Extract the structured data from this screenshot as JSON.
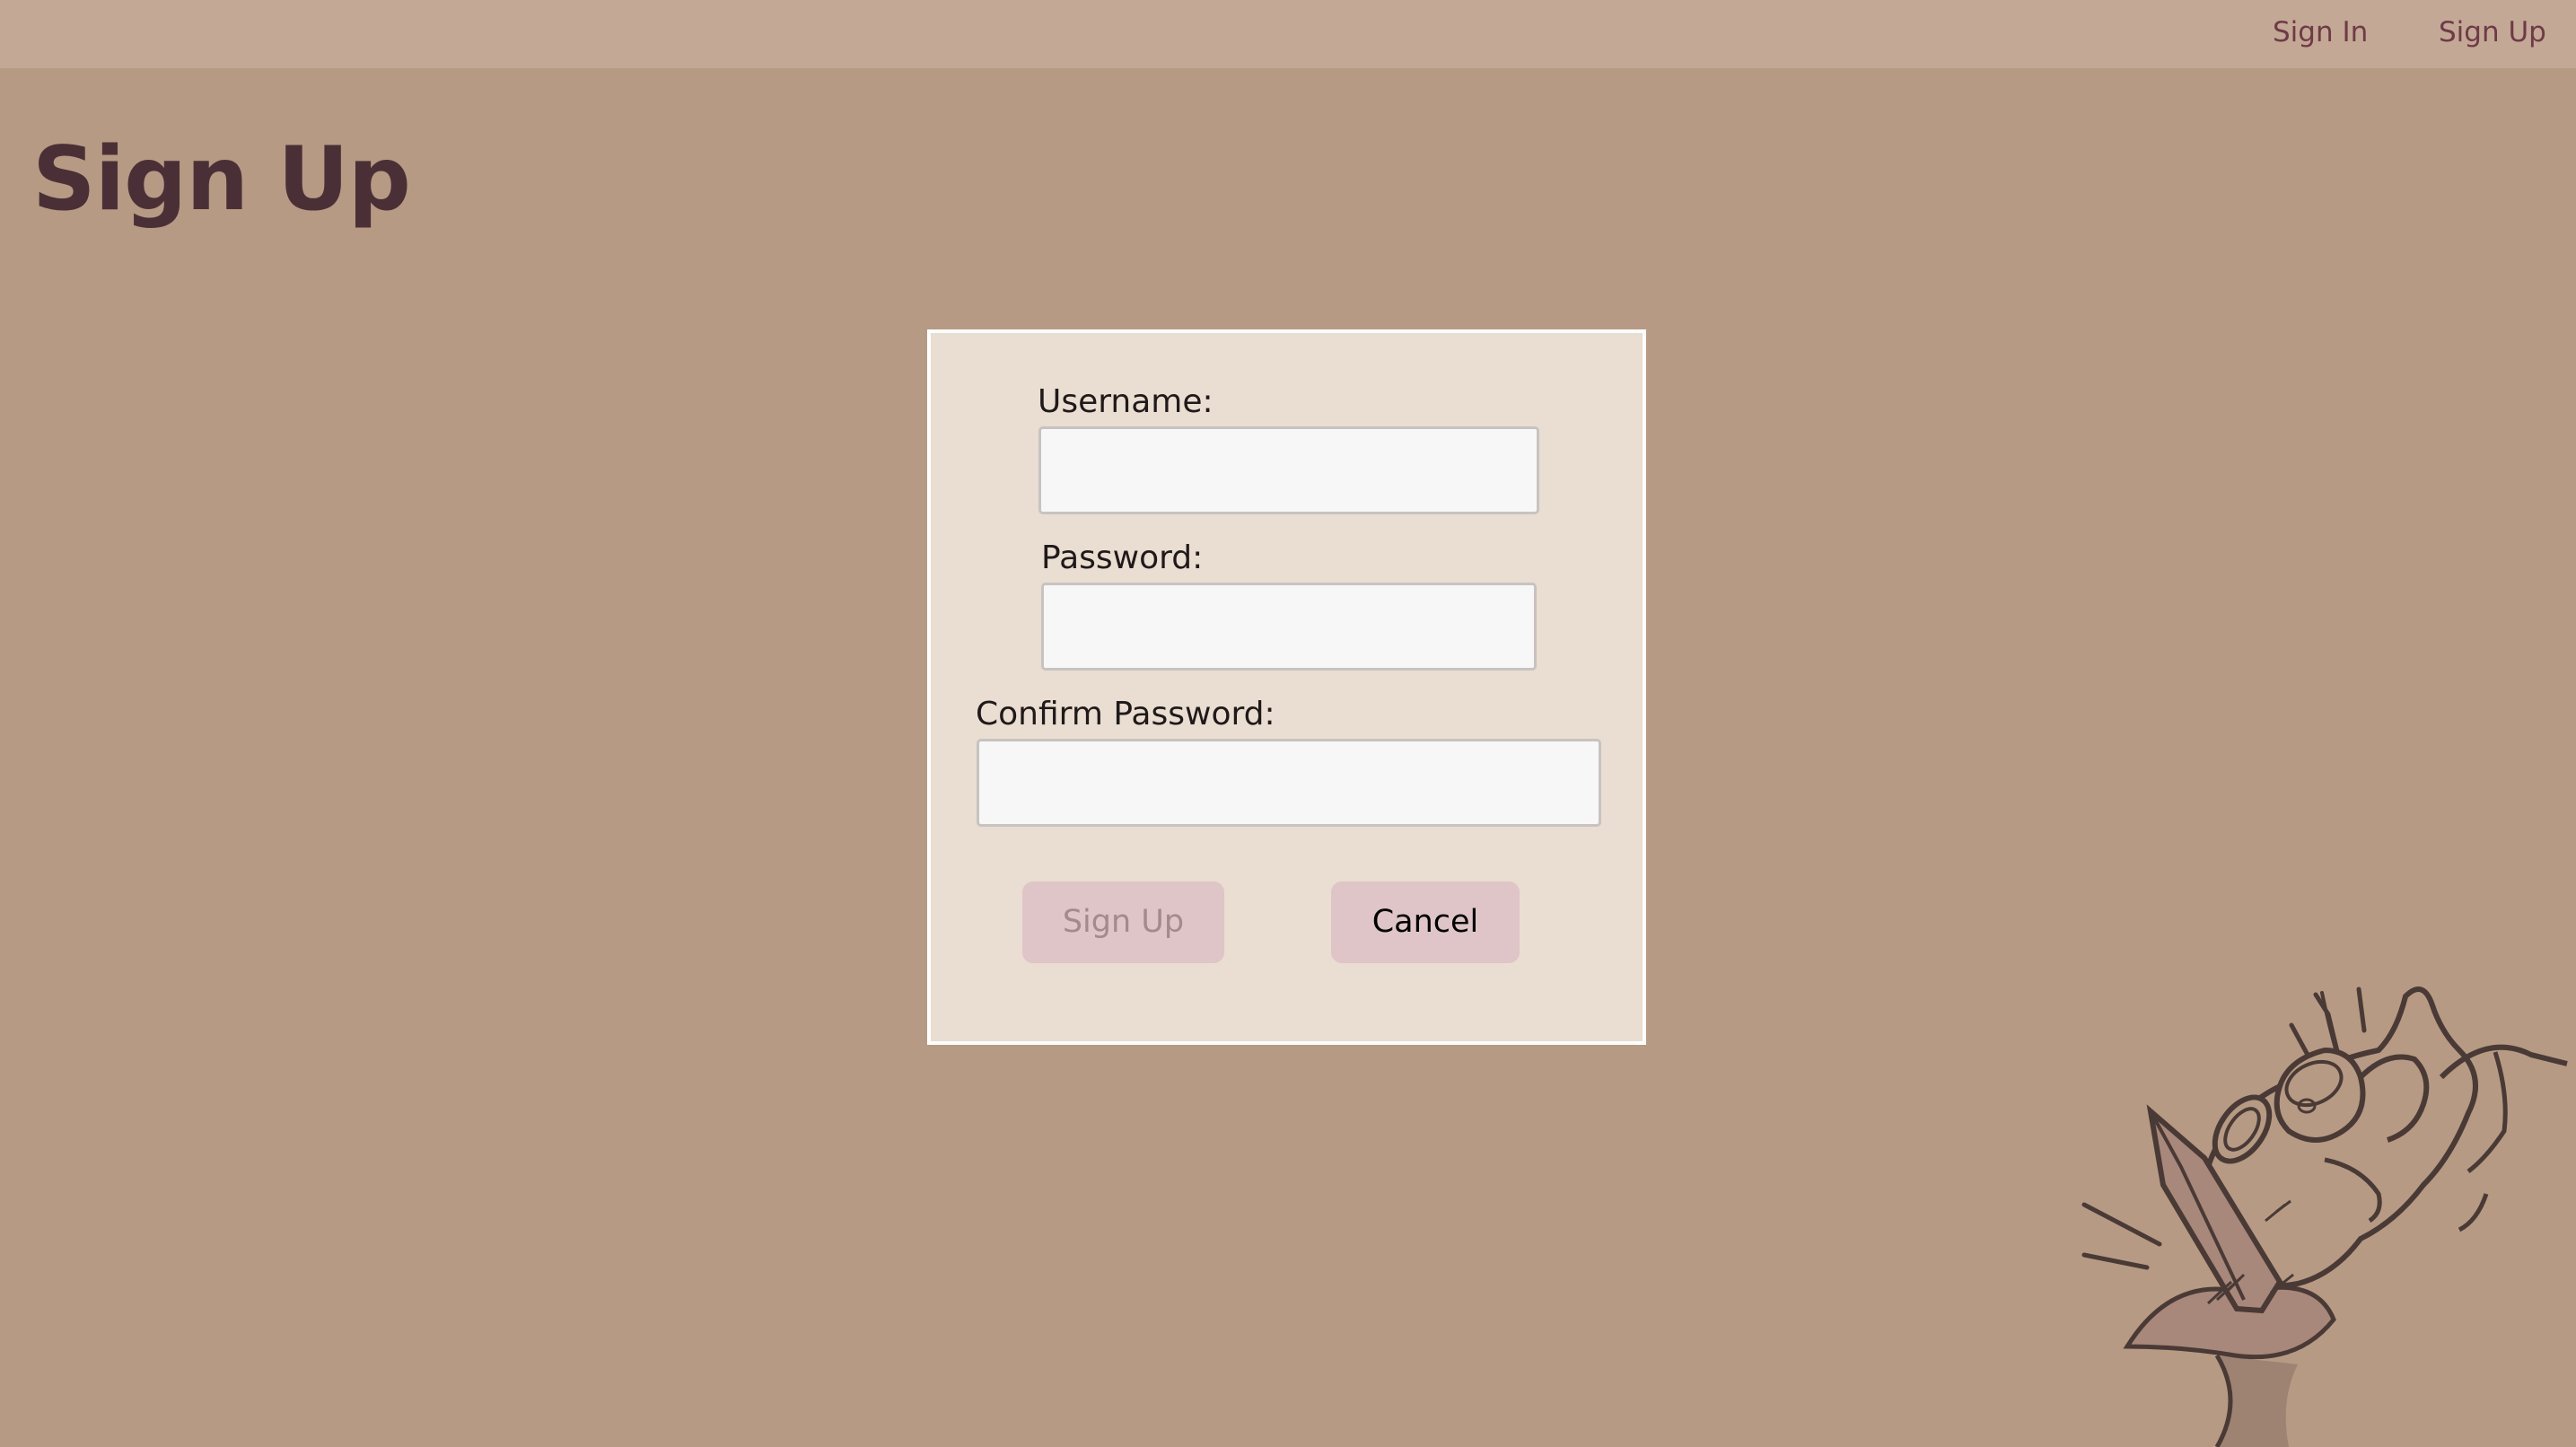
{
  "nav": {
    "sign_in": "Sign In",
    "sign_up": "Sign Up"
  },
  "page": {
    "title": "Sign Up"
  },
  "form": {
    "username_label": "Username:",
    "username_value": "",
    "password_label": "Password:",
    "password_value": "",
    "confirm_password_label": "Confirm Password:",
    "confirm_password_value": "",
    "sign_up_button": "Sign Up",
    "cancel_button": "Cancel"
  },
  "colors": {
    "background": "#b69a84",
    "topbar": "#c3a895",
    "nav_link": "#6f3a47",
    "title": "#4a3036",
    "card": "#eaddd1",
    "button": "#dfc5c7",
    "button_disabled_text": "#a38a8d"
  },
  "icons": {
    "illustration": "hand-holding-pencil-illustration"
  }
}
